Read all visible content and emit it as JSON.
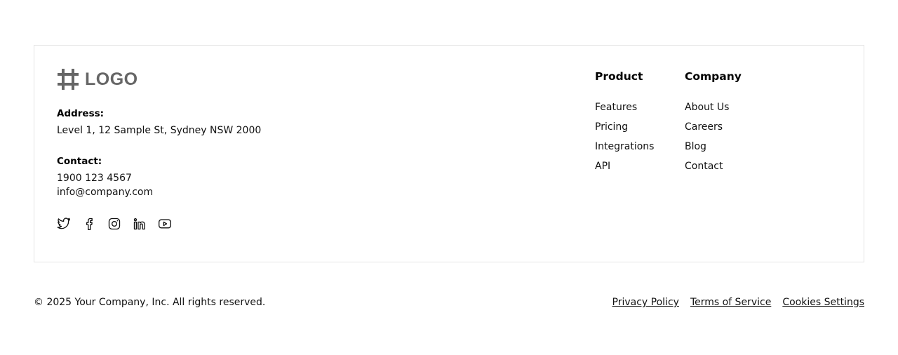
{
  "brand": {
    "logo_text": "LOGO",
    "logo_color": "#666666"
  },
  "address": {
    "label": "Address:",
    "value": "Level 1, 12 Sample St, Sydney NSW 2000"
  },
  "contact": {
    "label": "Contact:",
    "phone": "1900 123 4567",
    "email": "info@company.com"
  },
  "socials": [
    "twitter-icon",
    "facebook-icon",
    "instagram-icon",
    "linkedin-icon",
    "youtube-icon"
  ],
  "columns": [
    {
      "title": "Product",
      "links": [
        "Features",
        "Pricing",
        "Integrations",
        "API"
      ]
    },
    {
      "title": "Company",
      "links": [
        "About Us",
        "Careers",
        "Blog",
        "Contact"
      ]
    }
  ],
  "footer": {
    "copyright": "© 2025 Your Company, Inc. All rights reserved.",
    "legal_links": [
      "Privacy Policy",
      "Terms of Service",
      "Cookies Settings"
    ]
  },
  "colors": {
    "border": "#e4e4e4",
    "text": "#111111"
  }
}
